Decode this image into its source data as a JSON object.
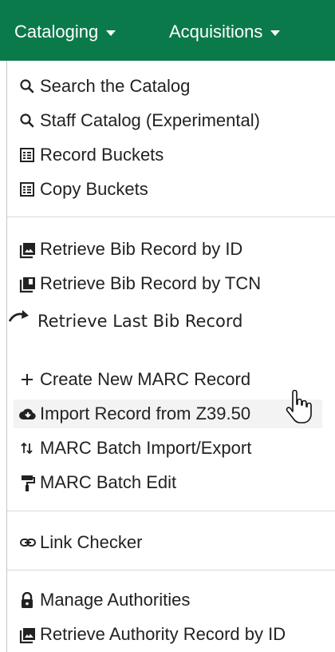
{
  "navbar": {
    "tabs": [
      {
        "label": "Cataloging",
        "icon": "caret-down-icon"
      },
      {
        "label": "Acquisitions",
        "icon": "caret-down-icon"
      }
    ]
  },
  "menu": {
    "groups": [
      {
        "items": [
          {
            "label": "Search the Catalog",
            "icon": "search-icon"
          },
          {
            "label": "Staff Catalog (Experimental)",
            "icon": "search-icon"
          },
          {
            "label": "Record Buckets",
            "icon": "list-icon"
          },
          {
            "label": "Copy Buckets",
            "icon": "list-icon"
          }
        ]
      },
      {
        "items": [
          {
            "label": "Retrieve Bib Record by ID",
            "icon": "photo-library-icon"
          },
          {
            "label": "Retrieve Bib Record by TCN",
            "icon": "library-books-icon"
          },
          {
            "label": "Retrieve Last Bib Record",
            "icon": "redo-arrow-icon"
          },
          {
            "label": "Create New MARC Record",
            "icon": "plus-icon"
          },
          {
            "label": "Import Record from Z39.50",
            "icon": "cloud-download-icon"
          },
          {
            "label": "MARC Batch Import/Export",
            "icon": "import-export-icon"
          },
          {
            "label": "MARC Batch Edit",
            "icon": "paint-roller-icon"
          }
        ]
      },
      {
        "items": [
          {
            "label": "Link Checker",
            "icon": "link-icon"
          }
        ]
      },
      {
        "items": [
          {
            "label": "Manage Authorities",
            "icon": "lock-icon"
          },
          {
            "label": "Retrieve Authority Record by ID",
            "icon": "photo-library-icon"
          }
        ]
      }
    ]
  },
  "colors": {
    "navbar_bg": "#0b7a4a",
    "text": "#222222",
    "hover_bg": "#f3f3f3"
  }
}
